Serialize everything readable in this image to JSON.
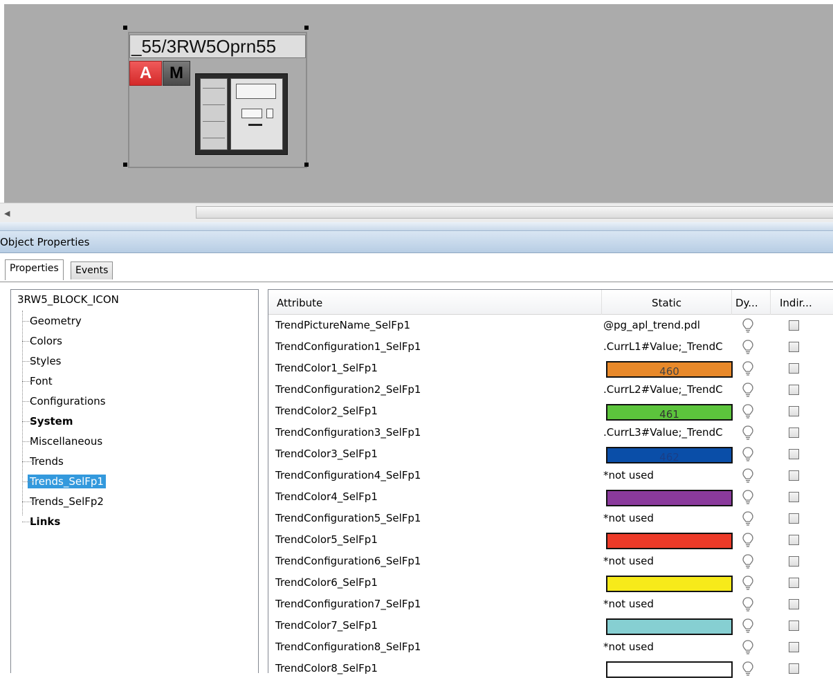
{
  "canvas": {
    "block_title": "_55/3RW5Oprn55",
    "mode_a": "A",
    "mode_m": "M"
  },
  "panel": {
    "header": "Object Properties",
    "tabs": [
      "Properties",
      "Events"
    ]
  },
  "tree": {
    "root": "3RW5_BLOCK_ICON",
    "items": [
      {
        "label": "Geometry",
        "bold": false,
        "selected": false
      },
      {
        "label": "Colors",
        "bold": false,
        "selected": false
      },
      {
        "label": "Styles",
        "bold": false,
        "selected": false
      },
      {
        "label": "Font",
        "bold": false,
        "selected": false
      },
      {
        "label": "Configurations",
        "bold": false,
        "selected": false
      },
      {
        "label": "System",
        "bold": true,
        "selected": false
      },
      {
        "label": "Miscellaneous",
        "bold": false,
        "selected": false
      },
      {
        "label": "Trends",
        "bold": false,
        "selected": false
      },
      {
        "label": "Trends_SelFp1",
        "bold": false,
        "selected": true
      },
      {
        "label": "Trends_SelFp2",
        "bold": false,
        "selected": false
      },
      {
        "label": "Links",
        "bold": true,
        "selected": false
      }
    ]
  },
  "table": {
    "columns": [
      "Attribute",
      "Static",
      "Dy...",
      "Indir..."
    ],
    "rows": [
      {
        "attribute": "TrendPictureName_SelFp1",
        "static": "@pg_apl_trend.pdl"
      },
      {
        "attribute": "TrendConfiguration1_SelFp1",
        "static": ".CurrL1#Value;_TrendC"
      },
      {
        "attribute": "TrendColor1_SelFp1",
        "color": "#e8892a",
        "color_label": "460",
        "label_color": "#444444"
      },
      {
        "attribute": "TrendConfiguration2_SelFp1",
        "static": ".CurrL2#Value;_TrendC"
      },
      {
        "attribute": "TrendColor2_SelFp1",
        "color": "#5cc43c",
        "color_label": "461",
        "label_color": "#333333"
      },
      {
        "attribute": "TrendConfiguration3_SelFp1",
        "static": ".CurrL3#Value;_TrendC"
      },
      {
        "attribute": "TrendColor3_SelFp1",
        "color": "#0a4ea8",
        "color_label": "462",
        "label_color": "#1a3e86"
      },
      {
        "attribute": "TrendConfiguration4_SelFp1",
        "static": "*not used"
      },
      {
        "attribute": "TrendColor4_SelFp1",
        "color": "#8a3a9c",
        "color_label": ""
      },
      {
        "attribute": "TrendConfiguration5_SelFp1",
        "static": "*not used"
      },
      {
        "attribute": "TrendColor5_SelFp1",
        "color": "#ec3a28",
        "color_label": ""
      },
      {
        "attribute": "TrendConfiguration6_SelFp1",
        "static": "*not used"
      },
      {
        "attribute": "TrendColor6_SelFp1",
        "color": "#f7ea1a",
        "color_label": ""
      },
      {
        "attribute": "TrendConfiguration7_SelFp1",
        "static": "*not used"
      },
      {
        "attribute": "TrendColor7_SelFp1",
        "color": "#86cfd2",
        "color_label": ""
      },
      {
        "attribute": "TrendConfiguration8_SelFp1",
        "static": "*not used"
      },
      {
        "attribute": "TrendColor8_SelFp1",
        "color": "#ffffff",
        "color_label": ""
      }
    ]
  }
}
